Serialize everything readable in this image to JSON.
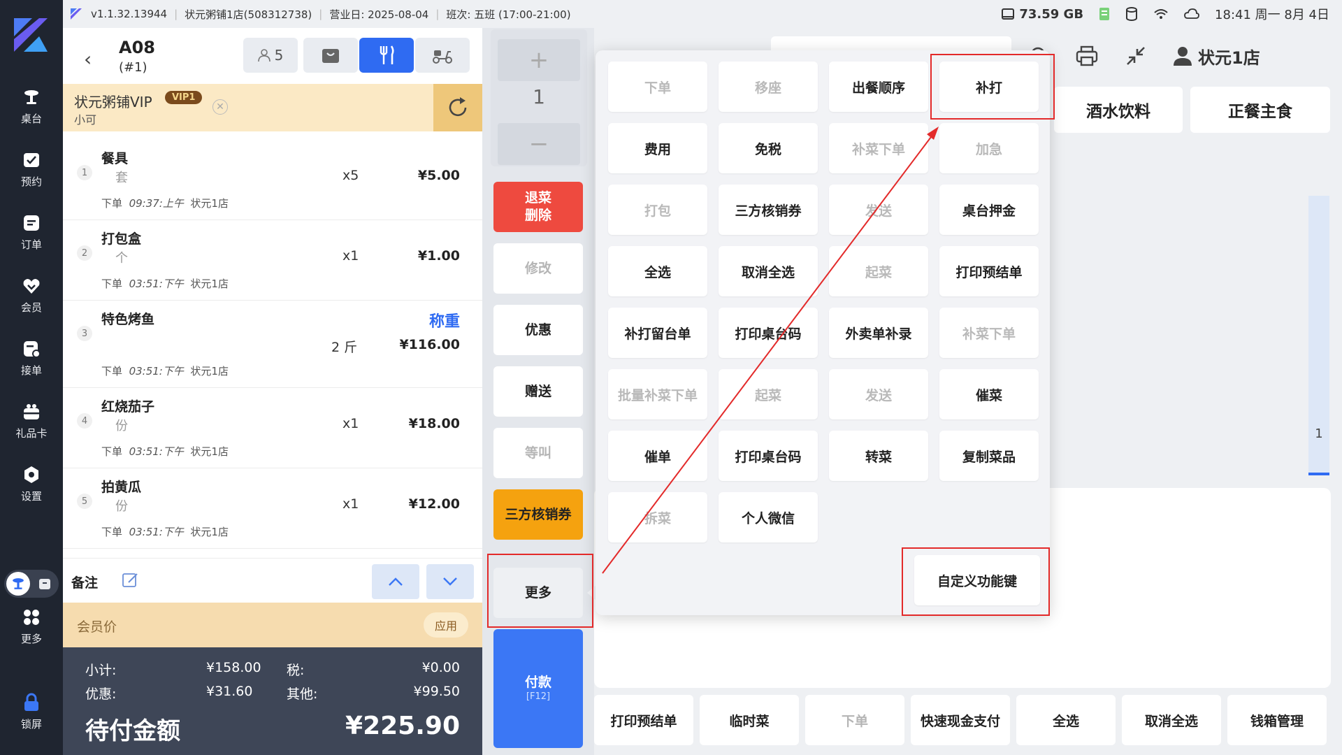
{
  "topbar": {
    "version": "v1.1.32.13944",
    "store": "状元粥铺1店(508312738)",
    "bizday": "营业日: 2025-08-04",
    "shift": "班次:  五班 (17:00-21:00)",
    "disk": "73.59 GB",
    "clock": "18:41 周一 8月 4日"
  },
  "sidebar": {
    "items": [
      {
        "label": "桌台",
        "icon": "table-icon"
      },
      {
        "label": "预约",
        "icon": "calendar-check-icon"
      },
      {
        "label": "订单",
        "icon": "order-icon"
      },
      {
        "label": "会员",
        "icon": "member-icon"
      },
      {
        "label": "接单",
        "icon": "accept-order-icon"
      },
      {
        "label": "礼品卡",
        "icon": "gift-card-icon"
      },
      {
        "label": "设置",
        "icon": "gear-icon"
      },
      {
        "label": "更多",
        "icon": "grid-icon"
      },
      {
        "label": "锁屏",
        "icon": "lock-icon"
      }
    ]
  },
  "order": {
    "table": "A08",
    "table_sub": "(#1)",
    "guests": "5",
    "member": {
      "name": "状元粥铺VIP",
      "level": "VIP1",
      "nick": "小可"
    },
    "items": [
      {
        "idx": "1",
        "name": "餐具",
        "unit": "套",
        "qty": "x5",
        "price": "¥5.00",
        "status": "下单",
        "time": "09:37:上午",
        "store": "状元1店",
        "weigh": ""
      },
      {
        "idx": "2",
        "name": "打包盒",
        "unit": "个",
        "qty": "x1",
        "price": "¥1.00",
        "status": "下单",
        "time": "03:51:下午",
        "store": "状元1店",
        "weigh": ""
      },
      {
        "idx": "3",
        "name": "特色烤鱼",
        "unit": "",
        "qty": "2 斤",
        "price": "¥116.00",
        "status": "下单",
        "time": "03:51:下午",
        "store": "状元1店",
        "weigh": "称重"
      },
      {
        "idx": "4",
        "name": "红烧茄子",
        "unit": "份",
        "qty": "x1",
        "price": "¥18.00",
        "status": "下单",
        "time": "03:51:下午",
        "store": "状元1店",
        "weigh": ""
      },
      {
        "idx": "5",
        "name": "拍黄瓜",
        "unit": "份",
        "qty": "x1",
        "price": "¥12.00",
        "status": "下单",
        "time": "03:51:下午",
        "store": "状元1店",
        "weigh": ""
      }
    ],
    "remark_label": "备注",
    "member_price_label": "会员价",
    "apply_label": "应用",
    "totals": {
      "subtotal_label": "小计:",
      "subtotal": "¥158.00",
      "tax_label": "税:",
      "tax": "¥0.00",
      "discount_label": "优惠:",
      "discount": "¥31.60",
      "other_label": "其他:",
      "other": "¥99.50",
      "due_label": "待付金额",
      "due": "¥225.90"
    }
  },
  "actions": {
    "plus": "+",
    "qty": "1",
    "minus": "−",
    "refund_line1": "退菜",
    "refund_line2": "删除",
    "modify": "修改",
    "discount": "优惠",
    "gift": "赠送",
    "wait": "等叫",
    "third": "三方核销券",
    "more": "更多",
    "pay": "付款",
    "pay_key": "[F12]"
  },
  "menu": {
    "categories": [
      "酒水饮料",
      "正餐主食"
    ],
    "page": "1",
    "bottom": [
      {
        "label": "打印预结单",
        "enabled": true
      },
      {
        "label": "临时菜",
        "enabled": true
      },
      {
        "label": "下单",
        "enabled": false
      },
      {
        "label": "快速现金支付",
        "enabled": true
      },
      {
        "label": "全选",
        "enabled": true
      },
      {
        "label": "取消全选",
        "enabled": true
      },
      {
        "label": "钱箱管理",
        "enabled": true
      }
    ]
  },
  "popup": {
    "buttons": [
      {
        "label": "下单",
        "enabled": false
      },
      {
        "label": "移座",
        "enabled": false
      },
      {
        "label": "出餐顺序",
        "enabled": true
      },
      {
        "label": "补打",
        "enabled": true
      },
      {
        "label": "费用",
        "enabled": true
      },
      {
        "label": "免税",
        "enabled": true
      },
      {
        "label": "补菜下单",
        "enabled": false
      },
      {
        "label": "加急",
        "enabled": false
      },
      {
        "label": "打包",
        "enabled": false
      },
      {
        "label": "三方核销券",
        "enabled": true
      },
      {
        "label": "发送",
        "enabled": false
      },
      {
        "label": "桌台押金",
        "enabled": true
      },
      {
        "label": "全选",
        "enabled": true
      },
      {
        "label": "取消全选",
        "enabled": true
      },
      {
        "label": "起菜",
        "enabled": false
      },
      {
        "label": "打印预结单",
        "enabled": true
      },
      {
        "label": "补打留台单",
        "enabled": true
      },
      {
        "label": "打印桌台码",
        "enabled": true
      },
      {
        "label": "外卖单补录",
        "enabled": true
      },
      {
        "label": "补菜下单",
        "enabled": false
      },
      {
        "label": "批量补菜下单",
        "enabled": false
      },
      {
        "label": "起菜",
        "enabled": false
      },
      {
        "label": "发送",
        "enabled": false
      },
      {
        "label": "催菜",
        "enabled": true
      },
      {
        "label": "催单",
        "enabled": true
      },
      {
        "label": "打印桌台码",
        "enabled": true
      },
      {
        "label": "转菜",
        "enabled": true
      },
      {
        "label": "复制菜品",
        "enabled": true
      },
      {
        "label": "拆菜",
        "enabled": false
      },
      {
        "label": "个人微信",
        "enabled": true
      }
    ],
    "custom_key": "自定义功能键"
  },
  "colors": {
    "accent": "#2f6bf2",
    "danger": "#ee4a3f",
    "warning": "#f5a20f",
    "highlight": "#e32a2a"
  }
}
